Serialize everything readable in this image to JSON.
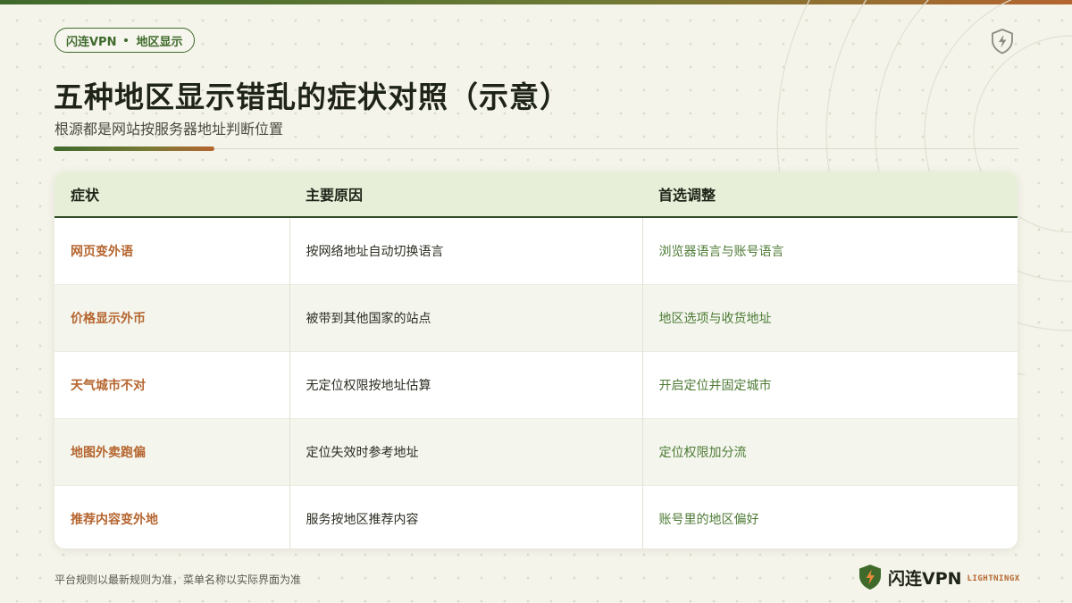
{
  "tag": {
    "brand": "闪连VPN",
    "topic": "地区显示"
  },
  "title": "五种地区显示错乱的症状对照（示意）",
  "subtitle": "根源都是网站按服务器地址判断位置",
  "table": {
    "headers": [
      "症状",
      "主要原因",
      "首选调整"
    ],
    "rows": [
      {
        "symptom": "网页变外语",
        "cause": "按网络地址自动切换语言",
        "fix": "浏览器语言与账号语言"
      },
      {
        "symptom": "价格显示外币",
        "cause": "被带到其他国家的站点",
        "fix": "地区选项与收货地址"
      },
      {
        "symptom": "天气城市不对",
        "cause": "无定位权限按地址估算",
        "fix": "开启定位并固定城市"
      },
      {
        "symptom": "地图外卖跑偏",
        "cause": "定位失效时参考地址",
        "fix": "定位权限加分流"
      },
      {
        "symptom": "推荐内容变外地",
        "cause": "服务按地区推荐内容",
        "fix": "账号里的地区偏好"
      }
    ]
  },
  "footer": {
    "note": "平台规则以最新规则为准，菜单名称以实际界面为准"
  },
  "brand": {
    "name": "闪连VPN",
    "sub": "LIGHTNINGX"
  },
  "colors": {
    "green": "#3f6a2c",
    "orange": "#b5652f",
    "header_bg": "#e8efd8",
    "background": "#f5f4ea"
  },
  "icons": {
    "corner": "shield-lightning-icon",
    "logo": "shield-lightning-logo-icon"
  }
}
